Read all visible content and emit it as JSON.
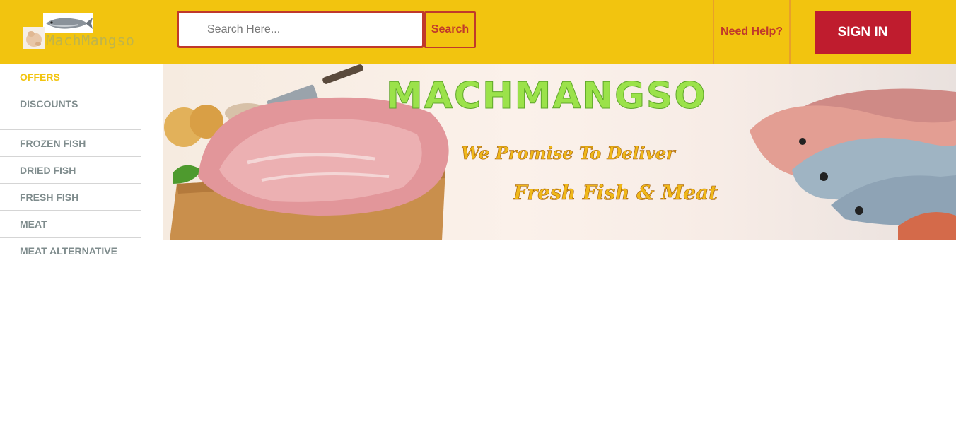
{
  "brand": {
    "name": "MachMangso"
  },
  "search": {
    "placeholder": "Search Here...",
    "value": "",
    "button_label": "Search"
  },
  "header": {
    "help_label": "Need Help?",
    "signin_label": "SIGN IN"
  },
  "sidebar": {
    "items": [
      {
        "label": "OFFERS",
        "active": true
      },
      {
        "label": "DISCOUNTS"
      },
      {
        "label": "FROZEN FISH"
      },
      {
        "label": "DRIED FISH"
      },
      {
        "label": "FRESH FISH"
      },
      {
        "label": "MEAT"
      },
      {
        "label": "MEAT ALTERNATIVE"
      }
    ]
  },
  "banner": {
    "title": "MACHMANGSO",
    "line1": "We Promise To Deliver",
    "line2": "Fresh Fish & Meat"
  },
  "colors": {
    "header_bg": "#f2c40f",
    "accent_red": "#c0392b",
    "signin_bg": "#bf1c2e",
    "sidebar_text": "#7f8c8d",
    "sidebar_active": "#f2c40f"
  }
}
